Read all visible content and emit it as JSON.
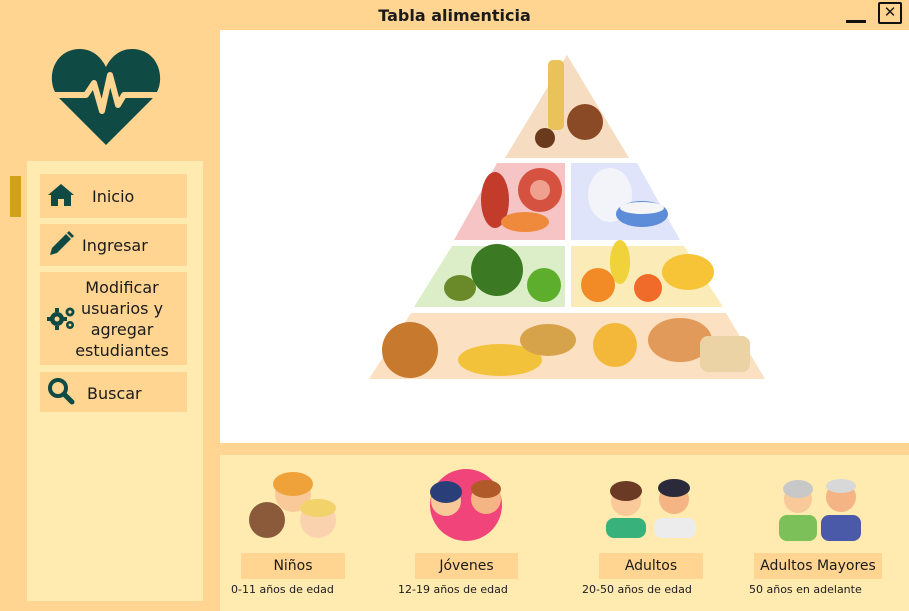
{
  "window": {
    "title": "Tabla alimenticia",
    "close_glyph": "✕"
  },
  "colors": {
    "background": "#ffd591",
    "panel": "#ffeab0",
    "accent": "#d1a11c",
    "icon": "#0f4a45",
    "content": "#ffffff"
  },
  "logo": {
    "icon": "heart-pulse-icon"
  },
  "sidebar": {
    "items": [
      {
        "label": "Inicio",
        "icon": "home-icon",
        "active": true
      },
      {
        "label": "Ingresar",
        "icon": "pencil-icon"
      },
      {
        "label_lines": [
          "Modificar",
          "usuarios y",
          "agregar",
          "estudiantes"
        ],
        "icon": "gears-icon"
      },
      {
        "label": "Buscar",
        "icon": "search-icon"
      }
    ]
  },
  "main": {
    "image": "food-pyramid-illustration",
    "pyramid_tiers": [
      "oil-sweets",
      "meat-fish",
      "dairy",
      "vegetables",
      "fruits",
      "grains-bread"
    ]
  },
  "age_groups": [
    {
      "label": "Niños",
      "range": "0-11 años de edad",
      "icon": "children-icon"
    },
    {
      "label": "Jóvenes",
      "range": "12-19 años de edad",
      "icon": "youth-icon"
    },
    {
      "label": "Adultos",
      "range": "20-50 años de edad",
      "icon": "adults-icon"
    },
    {
      "label": "Adultos Mayores",
      "range": "50 años en adelante",
      "icon": "elderly-icon"
    }
  ]
}
